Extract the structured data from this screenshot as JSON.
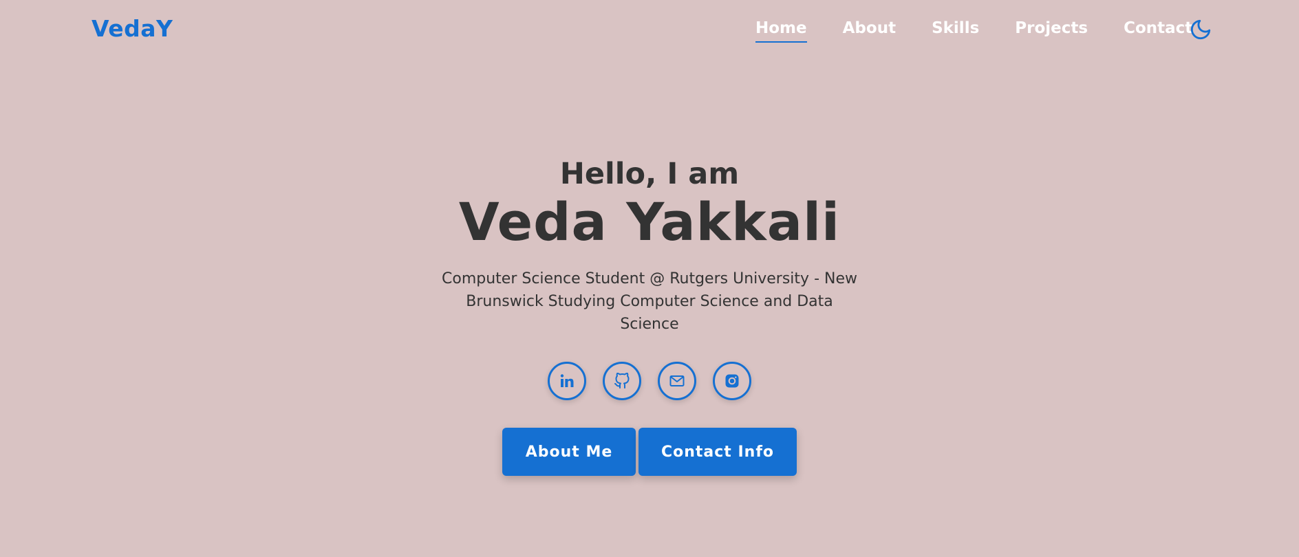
{
  "nav": {
    "logo": "VedaY",
    "links": [
      {
        "label": "Home",
        "active": true
      },
      {
        "label": "About",
        "active": false
      },
      {
        "label": "Skills",
        "active": false
      },
      {
        "label": "Projects",
        "active": false
      },
      {
        "label": "Contact",
        "active": false
      }
    ],
    "theme_toggle_icon": "moon-icon"
  },
  "hero": {
    "greeting": "Hello, I am",
    "name": "Veda Yakkali",
    "subtitle": "Computer Science Student @ Rutgers University - New Brunswick Studying Computer Science and Data Science",
    "socials": [
      {
        "icon": "linkedin-icon"
      },
      {
        "icon": "github-icon"
      },
      {
        "icon": "mail-icon"
      },
      {
        "icon": "instagram-icon"
      }
    ],
    "buttons": {
      "about_label": "About Me",
      "contact_label": "Contact Info"
    }
  },
  "colors": {
    "background": "#d9c3c3",
    "accent": "#1570d2",
    "text": "#333333",
    "nav_text": "#ffffff"
  }
}
